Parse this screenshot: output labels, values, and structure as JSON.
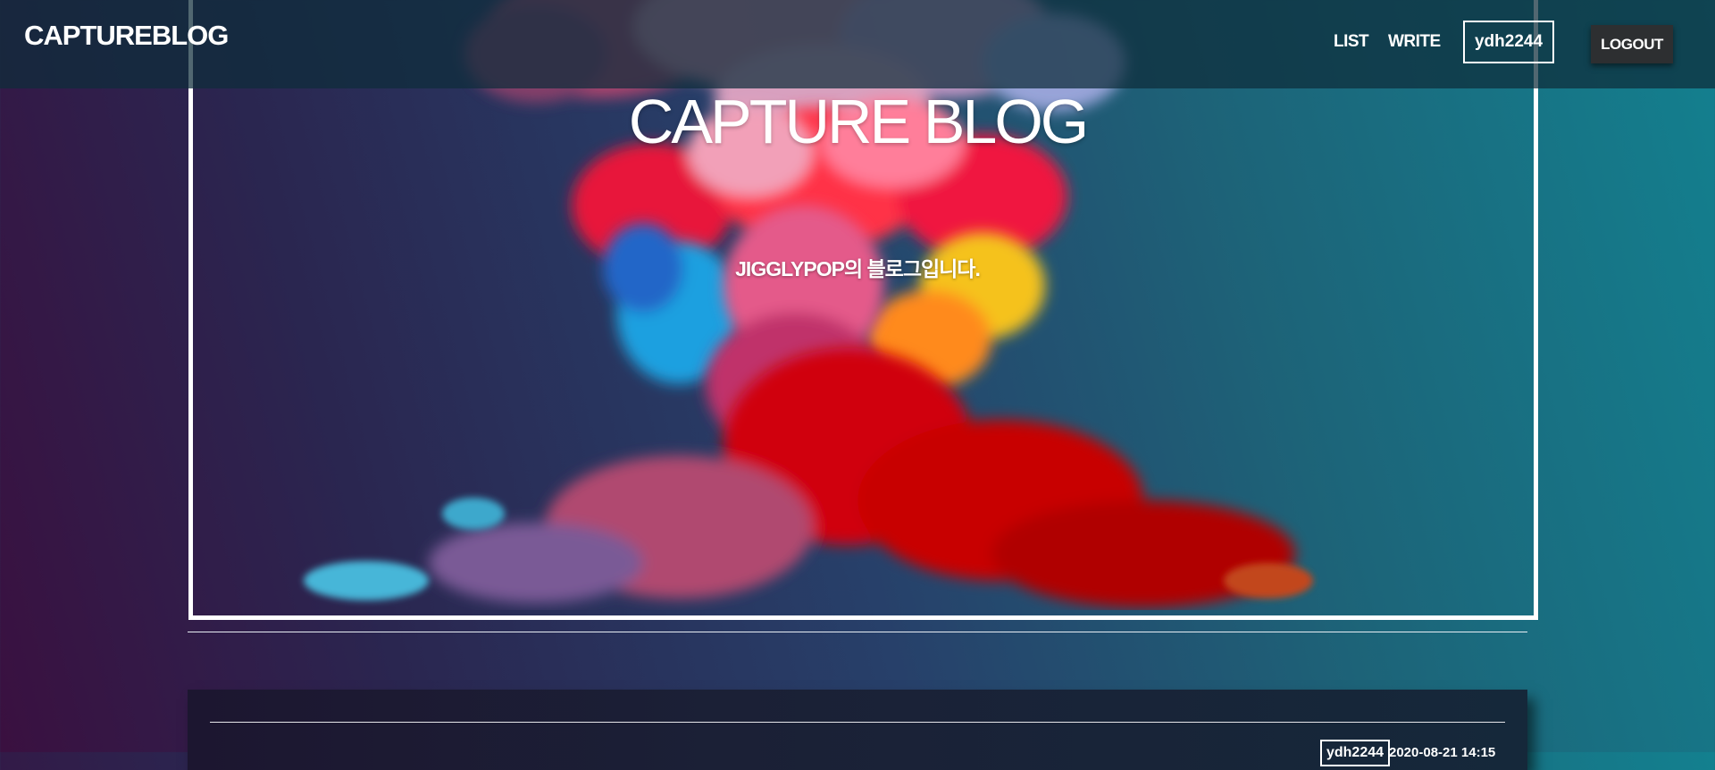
{
  "nav": {
    "brand": "CAPTUREBLOG",
    "list_label": "LIST",
    "write_label": "WRITE",
    "username": "ydh2244",
    "logout_label": "LOGOUT"
  },
  "hero": {
    "title": "CAPTURE BLOG",
    "subtitle": "JIGGLYPOP의 블로그입니다."
  },
  "post": {
    "author": "ydh2244",
    "date": "2020-08-21 14:15"
  },
  "colors": {
    "nav_bg": "#0e2d3a",
    "logout_bg": "#2d2f31",
    "smoke_red": "#d90000",
    "smoke_blue": "#1aa0e0",
    "smoke_yellow": "#f5c21a"
  }
}
